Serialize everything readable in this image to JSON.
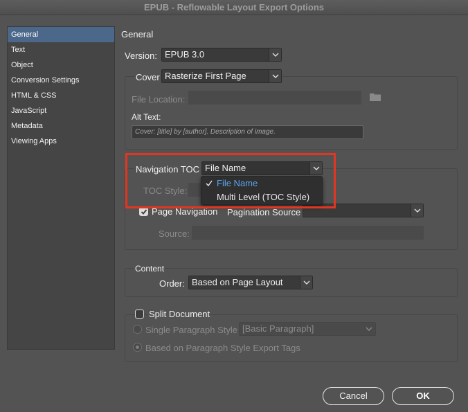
{
  "window": {
    "title": "EPUB - Reflowable Layout Export Options"
  },
  "sidebar": {
    "items": [
      {
        "label": "General"
      },
      {
        "label": "Text"
      },
      {
        "label": "Object"
      },
      {
        "label": "Conversion Settings"
      },
      {
        "label": "HTML & CSS"
      },
      {
        "label": "JavaScript"
      },
      {
        "label": "Metadata"
      },
      {
        "label": "Viewing Apps"
      }
    ],
    "selected_index": 0
  },
  "general": {
    "heading": "General",
    "version": {
      "label": "Version:",
      "value": "EPUB 3.0"
    },
    "cover": {
      "label": "Cover",
      "value": "Rasterize First Page",
      "file_location_label": "File Location:",
      "file_location_value": "",
      "alt_text_label": "Alt Text:",
      "alt_text_value": "Cover: [title] by [author]. Description of image.",
      "folder_icon": "folder-icon"
    },
    "navigation": {
      "toc_label": "Navigation TOC",
      "toc_value": "File Name",
      "toc_options": [
        "File Name",
        "Multi Level (TOC Style)"
      ],
      "toc_selected_index": 0,
      "toc_style_label": "TOC Style:",
      "page_navigation_label": "Page Navigation",
      "page_navigation_checked": true,
      "pagination_source_label": "Pagination Source",
      "pagination_source_value": "",
      "source_label": "Source:",
      "source_value": ""
    },
    "content": {
      "heading": "Content",
      "order_label": "Order:",
      "order_value": "Based on Page Layout"
    },
    "split": {
      "label": "Split Document",
      "checked": false,
      "single_paragraph_label": "Single Paragraph Style",
      "single_paragraph_value": "[Basic Paragraph]",
      "export_tags_label": "Based on Paragraph Style Export Tags"
    }
  },
  "buttons": {
    "cancel": "Cancel",
    "ok": "OK"
  },
  "colors": {
    "highlight": "#e33622",
    "selected_sidebar": "#4b6789",
    "selected_menu_text": "#5ba4f0"
  }
}
